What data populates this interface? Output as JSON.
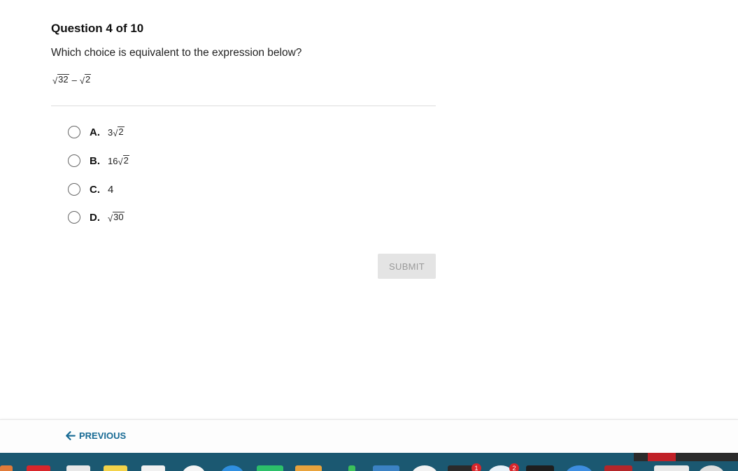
{
  "question": {
    "title": "Question 4 of 10",
    "prompt": "Which choice is equivalent to the expression below?",
    "expression": {
      "term1_radicand": "32",
      "operator": "–",
      "term2_radicand": "2"
    }
  },
  "choices": [
    {
      "letter": "A.",
      "coef": "3",
      "radicand": "2"
    },
    {
      "letter": "B.",
      "coef": "16",
      "radicand": "2"
    },
    {
      "letter": "C.",
      "text": "4"
    },
    {
      "letter": "D.",
      "coef": "",
      "radicand": "30"
    }
  ],
  "submit_label": "SUBMIT",
  "nav": {
    "previous_label": "PREVIOUS"
  },
  "dock": {
    "badges": [
      "1",
      "2"
    ]
  },
  "colors": {
    "accent": "#176a94",
    "dock": "#1b5871",
    "submit_bg": "#e4e4e4"
  }
}
